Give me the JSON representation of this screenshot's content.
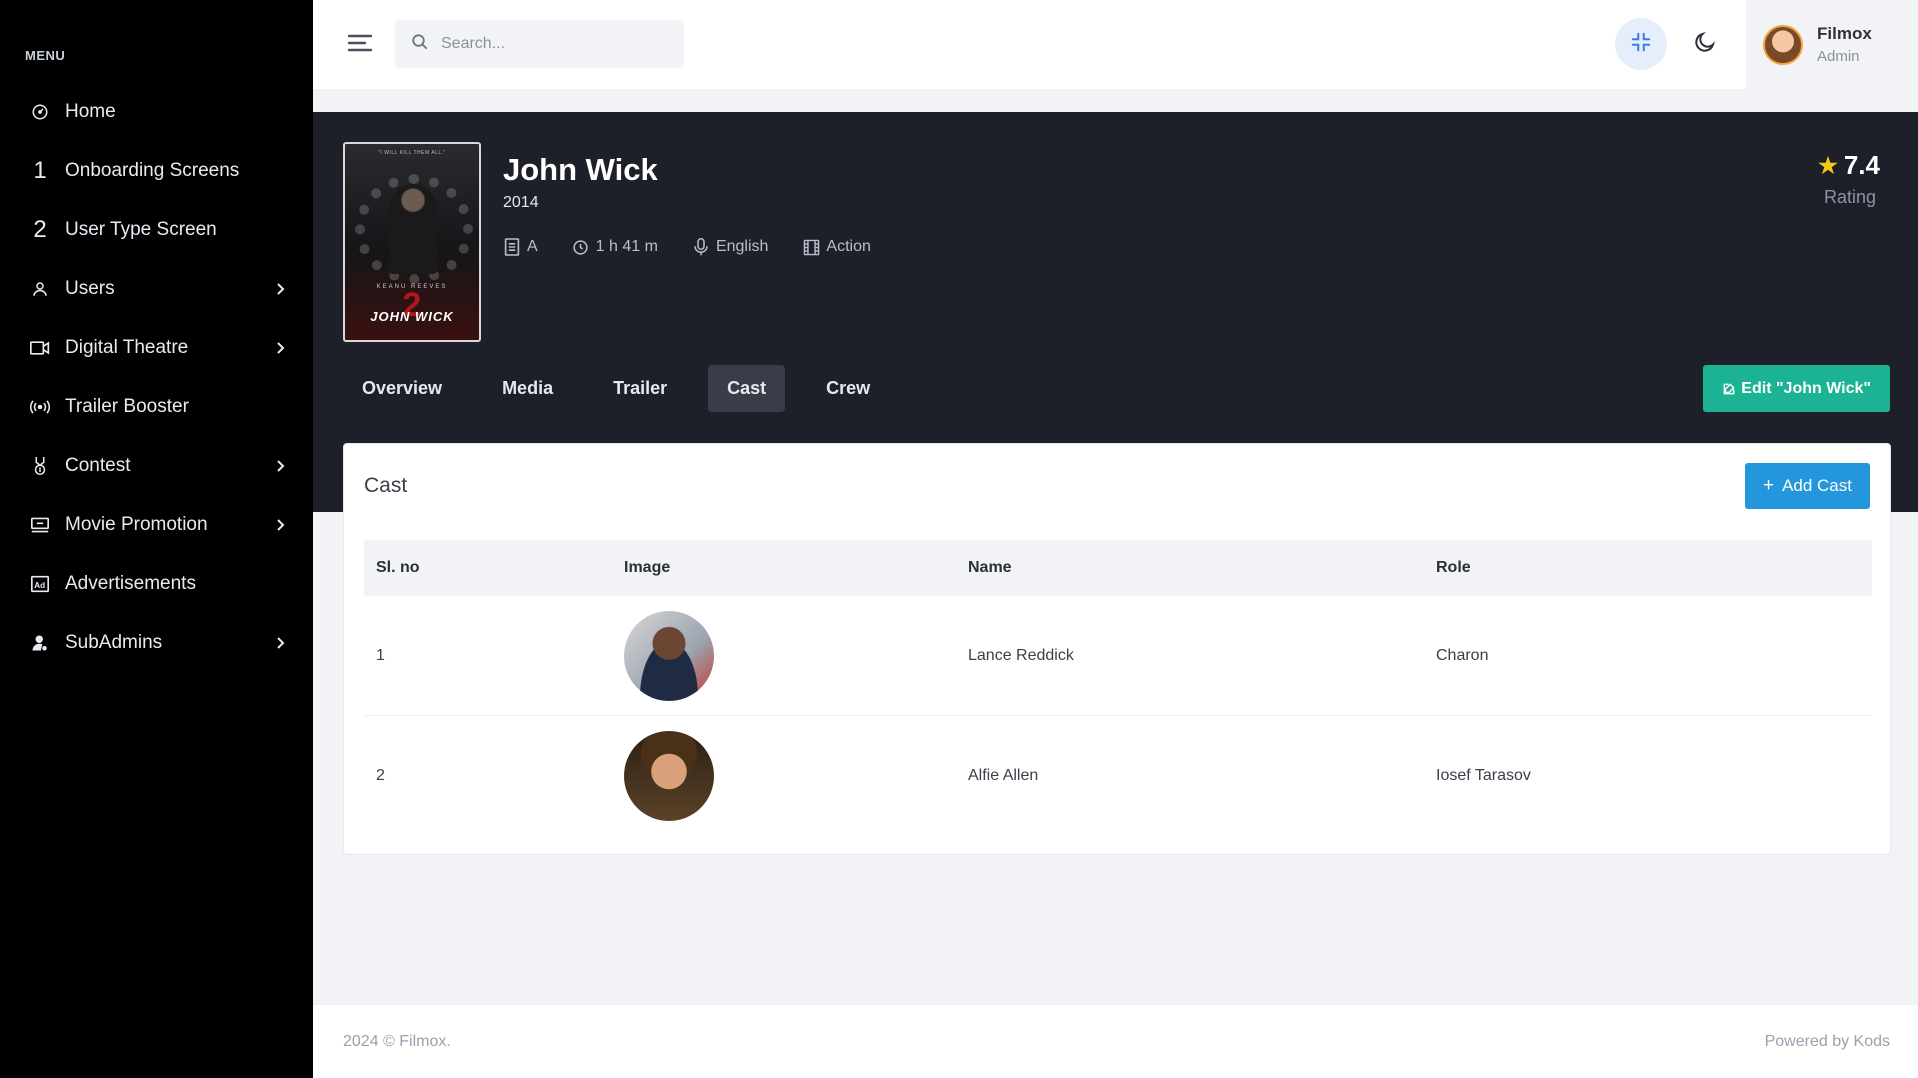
{
  "sidebar": {
    "menu_title": "MENU",
    "items": [
      {
        "label": "Home",
        "icon": "dashboard-icon",
        "has_children": false
      },
      {
        "label": "Onboarding Screens",
        "number": "1",
        "has_children": false
      },
      {
        "label": "User Type Screen",
        "number": "2",
        "has_children": false
      },
      {
        "label": "Users",
        "icon": "user-icon",
        "has_children": true
      },
      {
        "label": "Digital Theatre",
        "icon": "video-icon",
        "has_children": true
      },
      {
        "label": "Trailer Booster",
        "icon": "broadcast-icon",
        "has_children": false
      },
      {
        "label": "Contest",
        "icon": "medal-icon",
        "has_children": true
      },
      {
        "label": "Movie Promotion",
        "icon": "billboard-icon",
        "has_children": true
      },
      {
        "label": "Advertisements",
        "icon": "ad-icon",
        "has_children": false
      },
      {
        "label": "SubAdmins",
        "icon": "admin-icon",
        "has_children": true
      }
    ]
  },
  "topbar": {
    "search_placeholder": "Search...",
    "profile": {
      "name": "Filmox",
      "role": "Admin"
    }
  },
  "movie": {
    "title": "John Wick",
    "year": "2014",
    "certificate": "A",
    "duration": "1 h 41 m",
    "language": "English",
    "genre": "Action",
    "rating": "7.4",
    "rating_label": "Rating",
    "poster": {
      "tagline": "\"I WILL KILL THEM ALL.\"",
      "actor": "KEANU REEVES",
      "chapter": "2",
      "title": "JOHN WICK"
    }
  },
  "tabs": [
    {
      "label": "Overview",
      "active": false
    },
    {
      "label": "Media",
      "active": false
    },
    {
      "label": "Trailer",
      "active": false
    },
    {
      "label": "Cast",
      "active": true
    },
    {
      "label": "Crew",
      "active": false
    }
  ],
  "edit_button": "Edit \"John Wick\"",
  "cast": {
    "title": "Cast",
    "add_button": "Add Cast",
    "columns": [
      "Sl. no",
      "Image",
      "Name",
      "Role"
    ],
    "rows": [
      {
        "sl": "1",
        "name": "Lance Reddick",
        "role": "Charon"
      },
      {
        "sl": "2",
        "name": "Alfie Allen",
        "role": "Iosef Tarasov"
      }
    ]
  },
  "footer": {
    "left": "2024 © Filmox.",
    "right": "Powered by Kods"
  },
  "colors": {
    "accent_green": "#1bb394",
    "accent_blue": "#2496dc",
    "sidebar_bg": "#000000",
    "hero_bg": "#1e2029",
    "star": "#f5c518"
  }
}
